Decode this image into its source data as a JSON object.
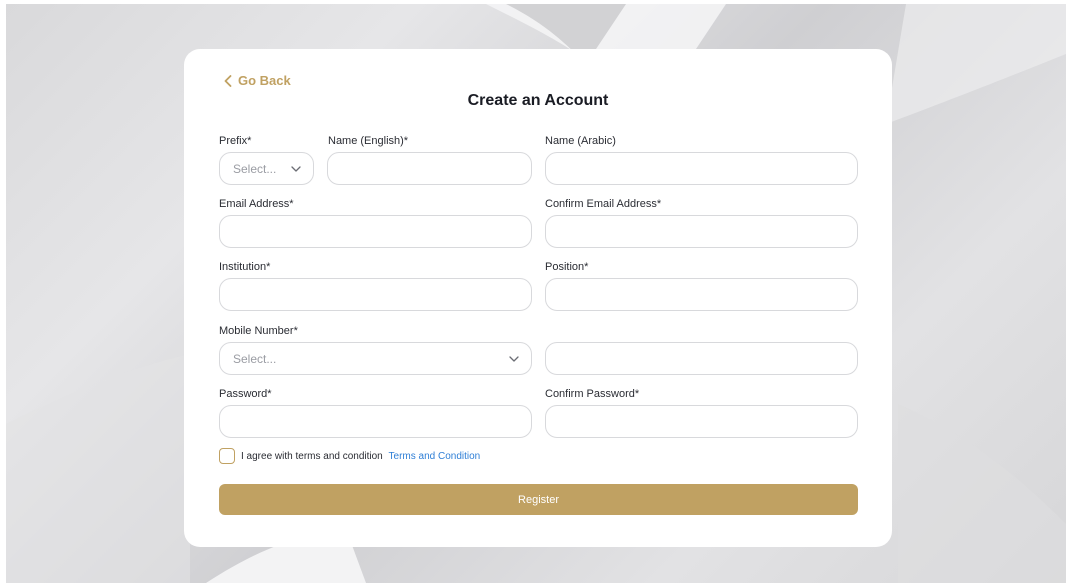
{
  "nav": {
    "go_back": "Go Back"
  },
  "form": {
    "title": "Create an Account",
    "prefix": {
      "label": "Prefix*",
      "placeholder": "Select..."
    },
    "name_english": {
      "label": "Name (English)*",
      "value": ""
    },
    "name_arabic": {
      "label": "Name (Arabic)",
      "value": ""
    },
    "email": {
      "label": "Email Address*",
      "value": ""
    },
    "confirm_email": {
      "label": "Confirm Email Address*",
      "value": ""
    },
    "institution": {
      "label": "Institution*",
      "value": ""
    },
    "position": {
      "label": "Position*",
      "value": ""
    },
    "mobile": {
      "label": "Mobile Number*",
      "code_placeholder": "Select...",
      "value": ""
    },
    "password": {
      "label": "Password*",
      "value": ""
    },
    "confirm_password": {
      "label": "Confirm Password*",
      "value": ""
    },
    "agree_text": "I agree with terms and condition",
    "terms_link": "Terms and Condition",
    "agreed": false,
    "register_label": "Register"
  },
  "colors": {
    "accent": "#c0a162",
    "link": "#2f7fd6",
    "title": "#1a1c24",
    "border": "#d8d9dc",
    "placeholder": "#9a9ca3"
  },
  "icons": {
    "go_back": "chevron-left-icon",
    "dropdown": "chevron-down-icon"
  }
}
